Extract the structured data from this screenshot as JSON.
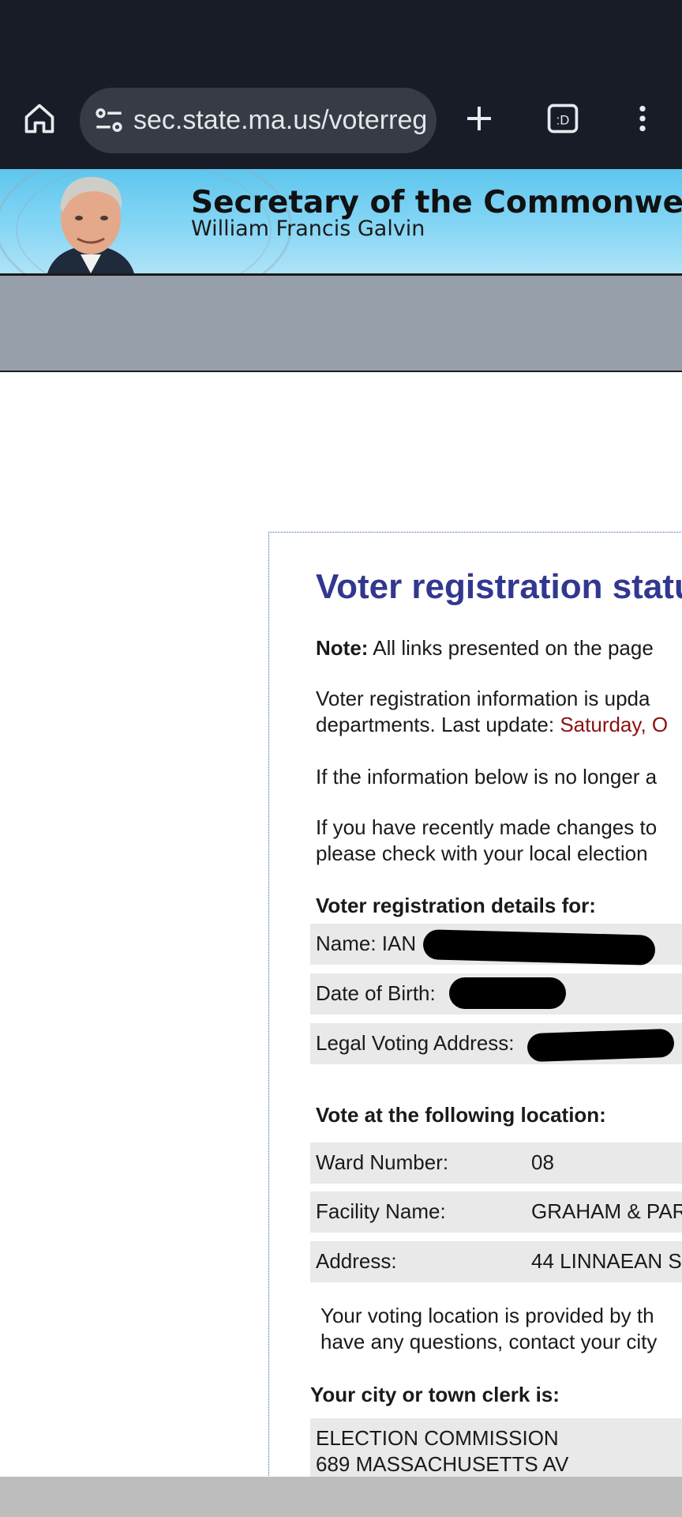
{
  "browser": {
    "url": "sec.state.ma.us/voterreg",
    "tab_button_label": ":D"
  },
  "header": {
    "title": "Secretary of the Commonwealth of",
    "subtitle": "William Francis Galvin"
  },
  "page": {
    "title": "Voter registration status",
    "note_label": "Note:",
    "note_text": "All links presented on the page",
    "update_line1": "Voter registration information is upda",
    "update_line2_prefix": "departments. Last update:",
    "update_date": "Saturday, O",
    "info_line": "If the information below is no longer a",
    "changes_line1": "If you have recently made changes to",
    "changes_line2": "please check with your local election",
    "details_heading": "Voter registration details for:",
    "details": {
      "name_label": "Name: IAN",
      "dob_label": "Date of Birth:",
      "address_label": "Legal Voting Address:"
    },
    "location_heading": "Vote at the following location:",
    "location": [
      {
        "label": "Ward Number:",
        "value": "08"
      },
      {
        "label": "Facility Name:",
        "value": "GRAHAM & PAR"
      },
      {
        "label": "Address:",
        "value": "44 LINNAEAN S"
      }
    ],
    "location_note_line1": "Your voting location is provided by th",
    "location_note_line2": "have any questions, contact your city",
    "clerk_heading": "Your city or town clerk is:",
    "clerk_line1": "ELECTION COMMISSION",
    "clerk_line2": "689 MASSACHUSETTS AV"
  }
}
